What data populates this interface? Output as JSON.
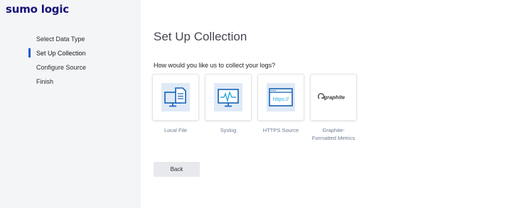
{
  "brand": {
    "logo_text": "sumo logic",
    "color": "#15117a"
  },
  "sidebar": {
    "steps": [
      {
        "label": "Select Data Type",
        "active": false
      },
      {
        "label": "Set Up Collection",
        "active": true
      },
      {
        "label": "Configure Source",
        "active": false
      },
      {
        "label": "Finish",
        "active": false
      }
    ],
    "active_color": "#1f5cd0"
  },
  "main": {
    "title": "Set Up Collection",
    "question": "How would you like us to collect your logs?",
    "options": [
      {
        "label": "Local File",
        "icon": "local-file-icon"
      },
      {
        "label": "Syslog",
        "icon": "syslog-monitor-icon"
      },
      {
        "label": "HTTPS Source",
        "icon": "https-browser-icon",
        "icon_text": "https://"
      },
      {
        "label": "Graphite-\nFormatted Metrics",
        "icon": "graphite-logo-icon",
        "icon_text": "graphite"
      }
    ],
    "back_label": "Back"
  }
}
